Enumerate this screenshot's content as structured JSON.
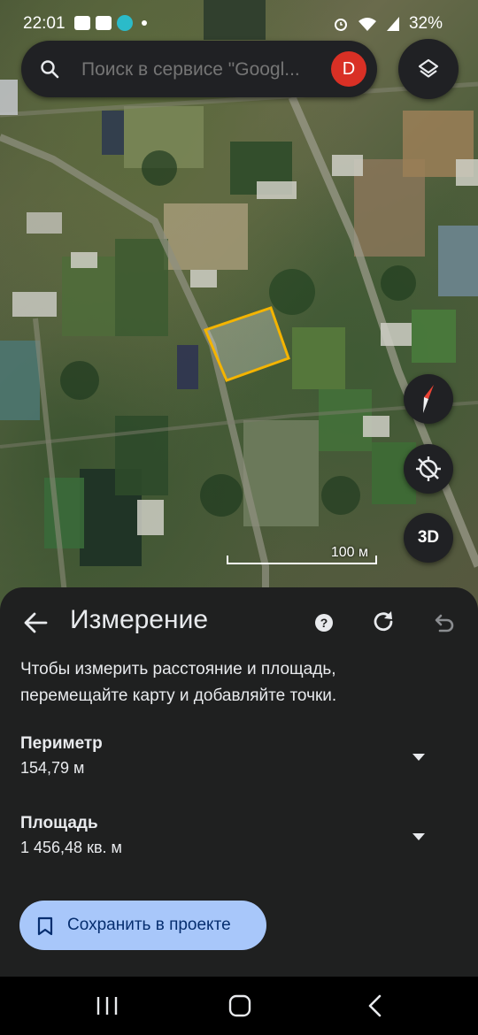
{
  "status_bar": {
    "time": "22:01",
    "battery": "32%"
  },
  "search": {
    "placeholder": "Поиск в сервисе \"Googl...",
    "avatar_letter": "D"
  },
  "map": {
    "scale_label": "100 м",
    "button_3d": "3D",
    "polygon_color": "#f4b400"
  },
  "sheet": {
    "title": "Измерение",
    "description": "Чтобы измерить расстояние и площадь, перемещайте карту и добавляйте точки.",
    "perimeter": {
      "label": "Периметр",
      "value": "154,79 м"
    },
    "area": {
      "label": "Площадь",
      "value": "1 456,48 кв. м"
    },
    "save_label": "Сохранить в проекте"
  },
  "colors": {
    "accent_button": "#a8c7fa",
    "sheet_bg": "#1f2020",
    "avatar_bg": "#d93025"
  }
}
